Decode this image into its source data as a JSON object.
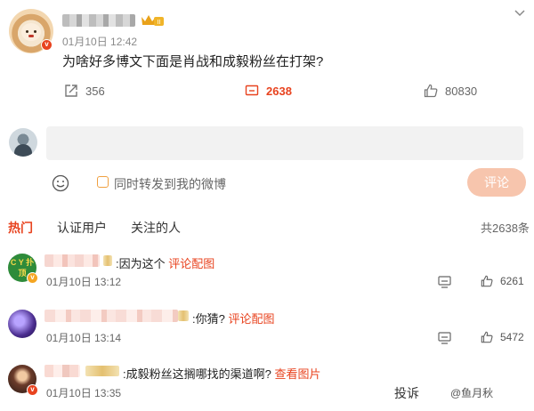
{
  "post": {
    "timestamp": "01月10日 12:42",
    "text": "为啥好多博文下面是肖战和成毅粉丝在打架?",
    "level_badge": "II",
    "actions": {
      "repost_count": "356",
      "comment_count": "2638",
      "like_count": "80830"
    }
  },
  "composer": {
    "placeholder": "",
    "repost_label": "同时转发到我的微博",
    "submit_label": "评论"
  },
  "tabs": {
    "hot": "热门",
    "verified": "认证用户",
    "following": "关注的人",
    "total": "共2638条"
  },
  "comments": [
    {
      "avatar_text": "C Y 扑顶",
      "text": ":因为这个",
      "link": "评论配图",
      "time": "01月10日 13:12",
      "like_count": "6261"
    },
    {
      "text": ":你猜?",
      "link": "评论配图",
      "time": "01月10日 13:14",
      "like_count": "5472"
    },
    {
      "text": ":成毅粉丝这搁哪找的渠道啊?",
      "link": "查看图片",
      "time": "01月10日 13:35",
      "report_label": "投诉",
      "watermark": "@鱼月秋"
    }
  ],
  "colors": {
    "accent": "#e8431f",
    "submit_bg": "#f7c5ad",
    "input_bg": "#f2f2f2"
  },
  "icons": [
    "chevron-down-icon",
    "repost-icon",
    "comment-icon",
    "like-icon",
    "emoji-icon",
    "verified-icon",
    "crown-icon"
  ]
}
